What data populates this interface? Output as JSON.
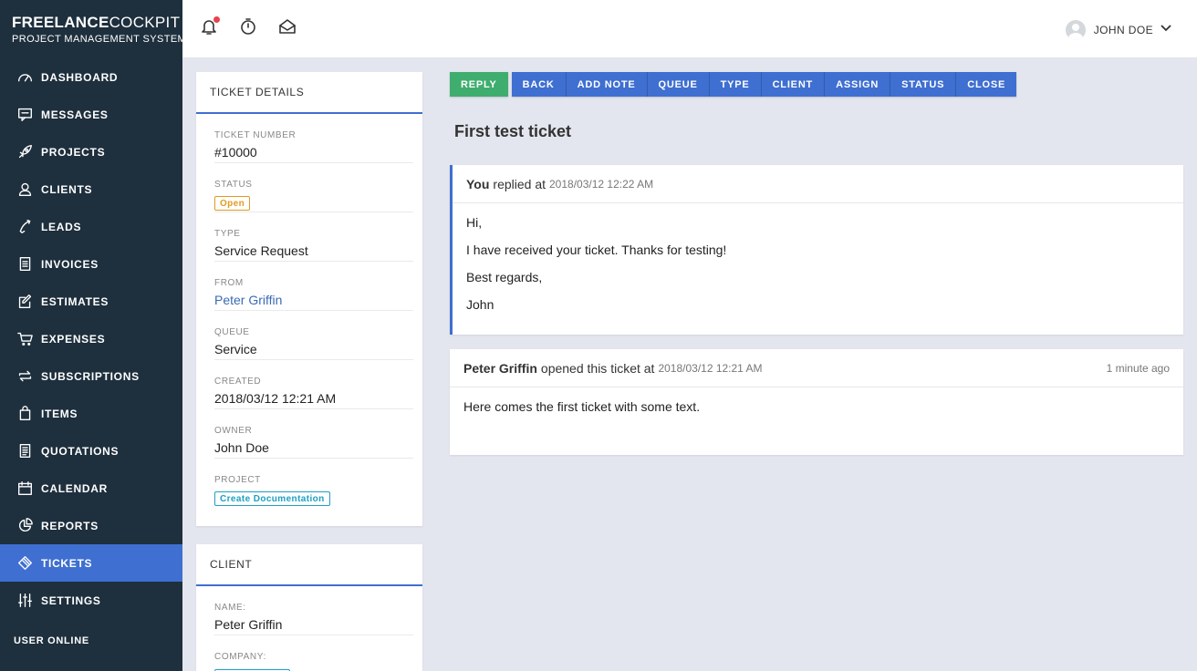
{
  "brand": {
    "name_bold": "FREELANCE",
    "name_light": "COCKPIT",
    "subtitle": "PROJECT MANAGEMENT SYSTEM"
  },
  "sidebar": {
    "items": [
      {
        "label": "DASHBOARD",
        "icon": "gauge-icon",
        "active": false
      },
      {
        "label": "MESSAGES",
        "icon": "message-icon",
        "active": false
      },
      {
        "label": "PROJECTS",
        "icon": "rocket-icon",
        "active": false
      },
      {
        "label": "CLIENTS",
        "icon": "user-icon",
        "active": false
      },
      {
        "label": "LEADS",
        "icon": "phone-icon",
        "active": false
      },
      {
        "label": "INVOICES",
        "icon": "invoice-icon",
        "active": false
      },
      {
        "label": "ESTIMATES",
        "icon": "edit-icon",
        "active": false
      },
      {
        "label": "EXPENSES",
        "icon": "cart-icon",
        "active": false
      },
      {
        "label": "SUBSCRIPTIONS",
        "icon": "repeat-icon",
        "active": false
      },
      {
        "label": "ITEMS",
        "icon": "bag-icon",
        "active": false
      },
      {
        "label": "QUOTATIONS",
        "icon": "document-icon",
        "active": false
      },
      {
        "label": "CALENDAR",
        "icon": "calendar-icon",
        "active": false
      },
      {
        "label": "REPORTS",
        "icon": "pie-chart-icon",
        "active": false
      },
      {
        "label": "TICKETS",
        "icon": "ticket-icon",
        "active": true
      },
      {
        "label": "SETTINGS",
        "icon": "sliders-icon",
        "active": false
      }
    ],
    "user_online": "USER ONLINE"
  },
  "header": {
    "user_name": "JOHN DOE"
  },
  "ticket_details": {
    "title": "TICKET DETAILS",
    "ticket_number_label": "TICKET NUMBER",
    "ticket_number": "#10000",
    "status_label": "STATUS",
    "status": "Open",
    "type_label": "TYPE",
    "type": "Service Request",
    "from_label": "FROM",
    "from": "Peter Griffin",
    "queue_label": "QUEUE",
    "queue": "Service",
    "created_label": "CREATED",
    "created": "2018/03/12 12:21 AM",
    "owner_label": "OWNER",
    "owner": "John Doe",
    "project_label": "PROJECT",
    "project": "Create Documentation"
  },
  "client": {
    "title": "CLIENT",
    "name_label": "NAME:",
    "name": "Peter Griffin",
    "company_label": "COMPANY:"
  },
  "toolbar": {
    "reply": "REPLY",
    "back": "BACK",
    "add_note": "ADD NOTE",
    "queue": "QUEUE",
    "type": "TYPE",
    "client": "CLIENT",
    "assign": "ASSIGN",
    "status": "STATUS",
    "close": "CLOSE"
  },
  "ticket": {
    "subject": "First test ticket",
    "messages": [
      {
        "author": "You",
        "action": "replied at",
        "timestamp": "2018/03/12 12:22 AM",
        "ago": "",
        "lines": [
          "Hi,",
          "I have received your ticket. Thanks for testing!",
          "Best regards,",
          "John"
        ]
      },
      {
        "author": "Peter Griffin",
        "action": "opened this ticket at",
        "timestamp": "2018/03/12 12:21 AM",
        "ago": "1 minute ago",
        "lines": [
          "Here comes the first ticket with some text."
        ]
      }
    ]
  },
  "colors": {
    "sidebar_bg": "#1e2f3d",
    "accent_blue": "#3f6fd0",
    "reply_green": "#3fad6e",
    "status_orange": "#e29a1f",
    "project_teal": "#1ea0c3"
  }
}
